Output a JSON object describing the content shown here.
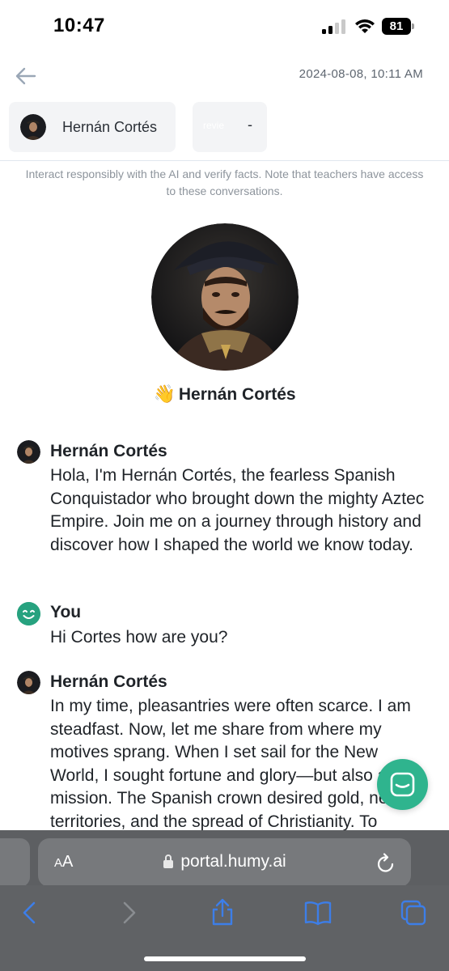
{
  "status_bar": {
    "time": "10:47",
    "battery": "81"
  },
  "header": {
    "date": "2024-08-08, 10:11 AM"
  },
  "character_chip": {
    "name": "Hernán Cortés"
  },
  "review_chip": {
    "label": "revie",
    "value": "-"
  },
  "disclaimer": "Interact responsibly with the AI and verify facts. Note that teachers have access to these conversations.",
  "hero": {
    "emoji": "👋",
    "name": "Hernán Cortés"
  },
  "messages": [
    {
      "author": "Hernán Cortés",
      "text": "Hola, I'm Hernán Cortés, the fearless Spanish Conquistador who brought down the mighty Aztec Empire. Join me on a journey through history and discover how I shaped the world we know today."
    },
    {
      "author": "You",
      "text": "Hi Cortes how are you?"
    },
    {
      "author": "Hernán Cortés",
      "text": "In my time, pleasantries were often scarce. I am steadfast. Now, let me share from where my motives sprang. When I set sail for the New World, I sought fortune and glory—but also a mission. The Spanish crown desired gold, new territories, and the spread of Christianity. To"
    }
  ],
  "browser": {
    "aa_small": "A",
    "aa_big": "A",
    "url": "portal.humy.ai"
  },
  "colors": {
    "accent": "#2fb48e",
    "you_avatar": "#27a27f",
    "safari_bar": "#606265",
    "safari_icon": "#3d7ee8"
  },
  "icons": {
    "back": "arrow-left-icon",
    "launcher": "chat-bubble-icon",
    "lock": "lock-icon",
    "reload": "reload-icon",
    "toolbar": [
      "chevron-left-icon",
      "chevron-right-icon",
      "share-icon",
      "bookmarks-icon",
      "tabs-icon"
    ]
  }
}
